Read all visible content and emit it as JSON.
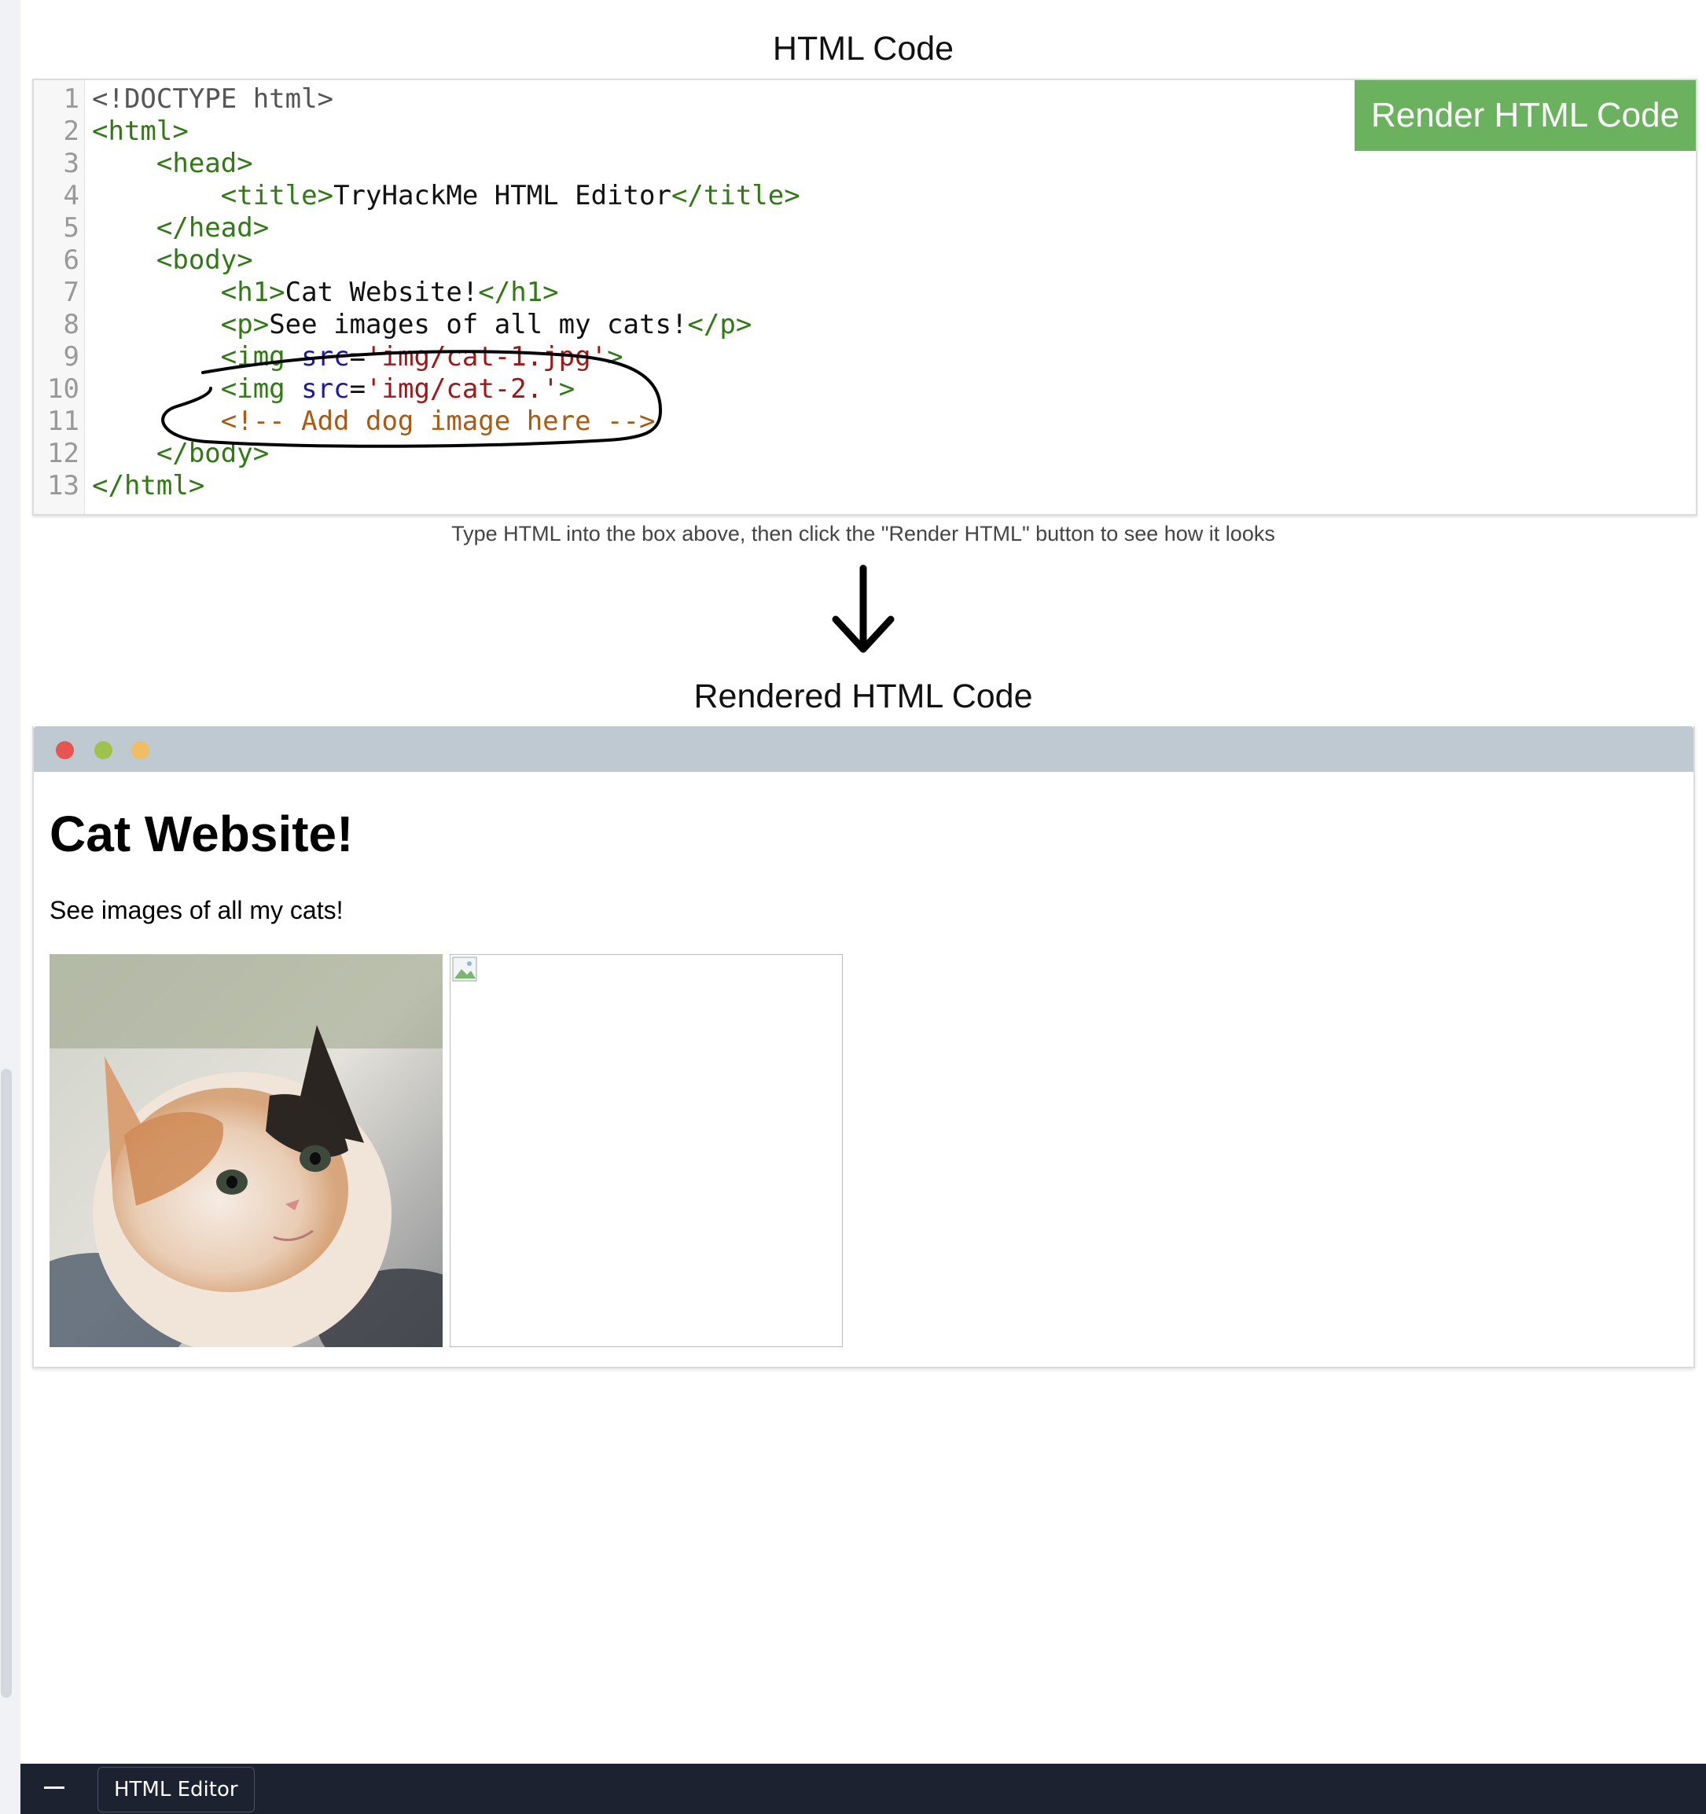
{
  "editor_section": {
    "title": "HTML Code",
    "render_button_label": "Render HTML Code",
    "hint": "Type HTML into the box above, then click the \"Render HTML\" button to see how it looks",
    "line_numbers": [
      "1",
      "2",
      "3",
      "4",
      "5",
      "6",
      "7",
      "8",
      "9",
      "10",
      "11",
      "12",
      "13"
    ],
    "code": {
      "l1": "<!DOCTYPE html>",
      "l2": "<html>",
      "l3_indent": "    ",
      "l3": "<head>",
      "l4_indent": "        ",
      "l4_open": "<title>",
      "l4_text": "TryHackMe HTML Editor",
      "l4_close": "</title>",
      "l5_indent": "    ",
      "l5": "</head>",
      "l6_indent": "    ",
      "l6": "<body>",
      "l7_indent": "        ",
      "l7_open": "<h1>",
      "l7_text": "Cat Website!",
      "l7_close": "</h1>",
      "l8_indent": "        ",
      "l8_open": "<p>",
      "l8_text": "See images of all my cats!",
      "l8_close": "</p>",
      "l9_indent": "        ",
      "l9_tag": "<img",
      "l9_attr": "src",
      "l9_eq": "=",
      "l9_val": "'img/cat-1.jpg'",
      "l9_end": ">",
      "l10_indent": "        ",
      "l10_tag": "<img",
      "l10_attr": "src",
      "l10_eq": "=",
      "l10_val": "'img/cat-2.'",
      "l10_end": ">",
      "l11_indent": "        ",
      "l11": "<!-- Add dog image here -->",
      "l12_indent": "    ",
      "l12": "</body>",
      "l13": "</html>"
    }
  },
  "rendered_section": {
    "title": "Rendered HTML Code",
    "page_heading": "Cat Website!",
    "page_paragraph": "See images of all my cats!"
  },
  "taskbar": {
    "app_label": "HTML Editor"
  },
  "colors": {
    "button_green": "#6ab25d",
    "tag_green": "#2f7a12",
    "attr_blue": "#1a1aa6",
    "string_red": "#a11616",
    "comment_orange": "#aa5a12",
    "browser_bar": "#bfc9d2",
    "taskbar": "#1d2230"
  },
  "icons": [
    "down-arrow-icon",
    "window-close-dot",
    "window-maximize-dot",
    "window-minimize-dot",
    "broken-image-icon"
  ]
}
